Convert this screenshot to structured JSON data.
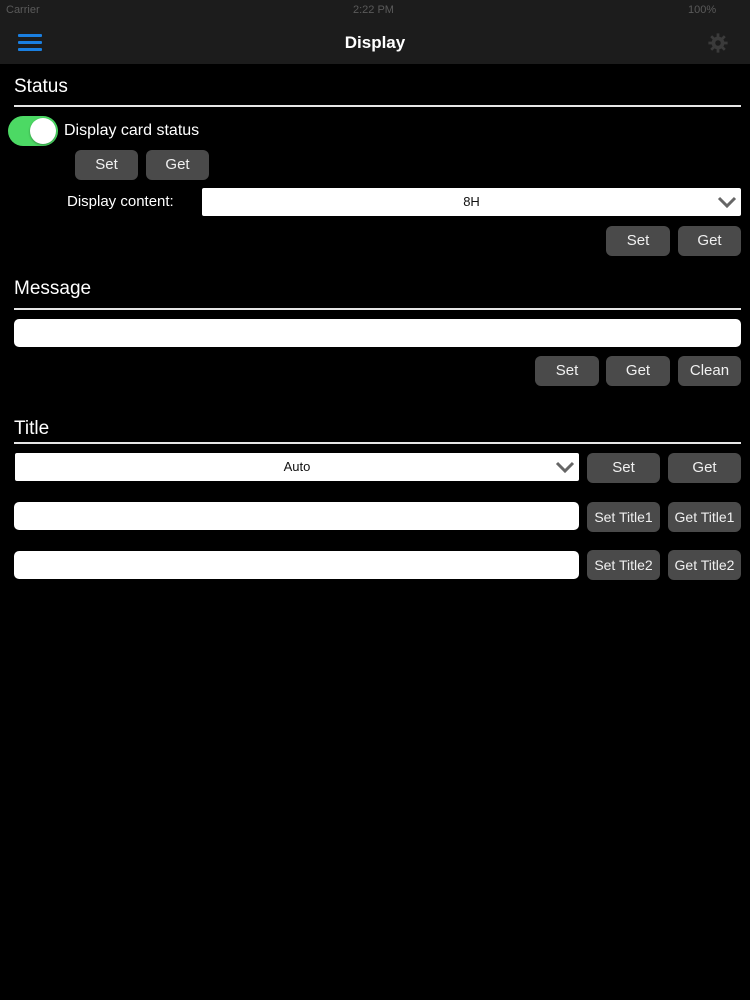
{
  "status_bar": {
    "carrier": "Carrier",
    "time": "2:22 PM",
    "battery": "100%"
  },
  "nav": {
    "title": "Display",
    "menu_icon": "hamburger-menu-icon",
    "settings_icon": "gear-icon"
  },
  "accent": "#1a7fe0",
  "status": {
    "title": "Status",
    "toggle_label": "Display card status",
    "toggle_on": true,
    "set_label": "Set",
    "get_label": "Get",
    "content_label": "Display content:",
    "content_value": "8H",
    "content_set_label": "Set",
    "content_get_label": "Get"
  },
  "message": {
    "title": "Message",
    "value": "",
    "set_label": "Set",
    "get_label": "Get",
    "clean_label": "Clean"
  },
  "title_section": {
    "title": "Title",
    "mode_value": "Auto",
    "set_label": "Set",
    "get_label": "Get",
    "title1_value": "",
    "set_title1_label": "Set Title1",
    "get_title1_label": "Get Title1",
    "title2_value": "",
    "set_title2_label": "Set Title2",
    "get_title2_label": "Get Title2"
  }
}
